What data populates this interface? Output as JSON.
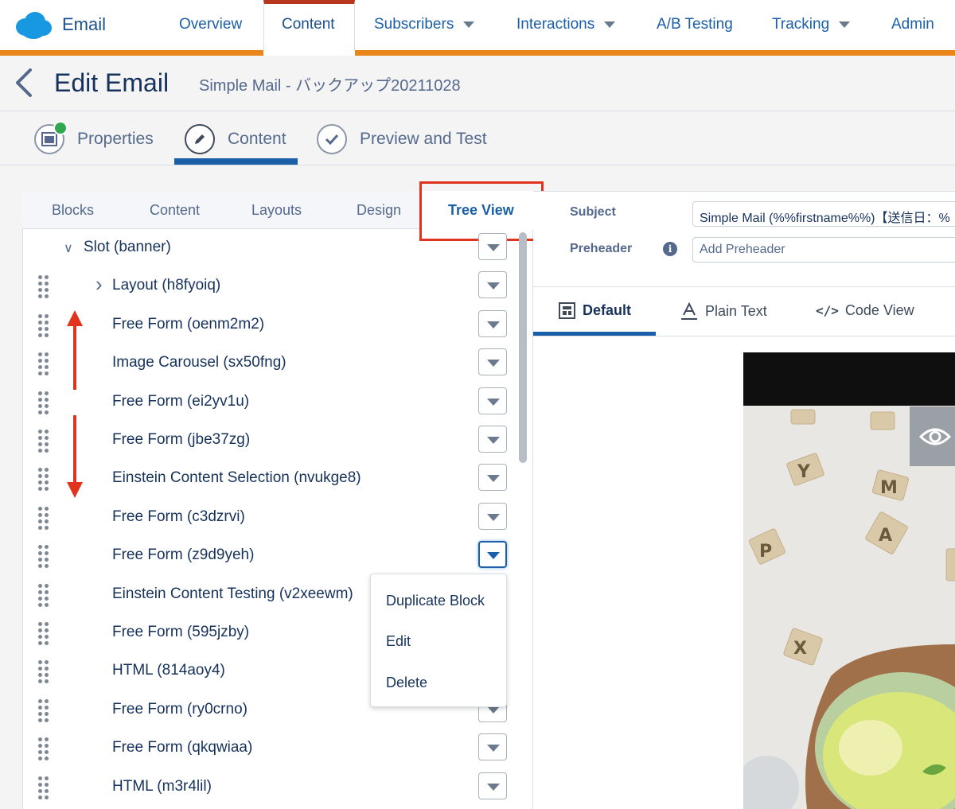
{
  "topnav": {
    "app_name": "Email",
    "items": [
      {
        "label": "Overview"
      },
      {
        "label": "Content",
        "active": true
      },
      {
        "label": "Subscribers",
        "dropdown": true
      },
      {
        "label": "Interactions",
        "dropdown": true
      },
      {
        "label": "A/B Testing"
      },
      {
        "label": "Tracking",
        "dropdown": true
      },
      {
        "label": "Admin"
      }
    ],
    "accent_color": "#e8861c"
  },
  "header": {
    "title": "Edit Email",
    "subtitle": "Simple Mail - バックアップ20211028"
  },
  "steps": [
    {
      "label": "Properties",
      "icon": "properties-icon",
      "completed": true
    },
    {
      "label": "Content",
      "icon": "pencil-icon",
      "active": true
    },
    {
      "label": "Preview and Test",
      "icon": "checkmark-icon"
    }
  ],
  "left_tabs": [
    {
      "label": "Blocks"
    },
    {
      "label": "Content"
    },
    {
      "label": "Layouts"
    },
    {
      "label": "Design"
    },
    {
      "label": "Tree View",
      "active": true
    }
  ],
  "tree": [
    {
      "label": "Slot (banner)",
      "type": "slot",
      "expanded": true
    },
    {
      "label": "Layout (h8fyoiq)",
      "type": "layout",
      "collapsed": true
    },
    {
      "label": "Free Form (oenm2m2)"
    },
    {
      "label": "Image Carousel (sx50fng)"
    },
    {
      "label": "Free Form (ei2yv1u)"
    },
    {
      "label": "Free Form (jbe37zg)"
    },
    {
      "label": "Einstein Content Selection (nvukge8)"
    },
    {
      "label": "Free Form (c3dzrvi)"
    },
    {
      "label": "Free Form (z9d9yeh)",
      "menu_open": true
    },
    {
      "label": "Einstein Content Testing (v2xeewm)"
    },
    {
      "label": "Free Form (595jzby)"
    },
    {
      "label": "HTML (814aoy4)"
    },
    {
      "label": "Free Form (ry0crno)"
    },
    {
      "label": "Free Form (qkqwiaa)"
    },
    {
      "label": "HTML (m3r4lil)"
    }
  ],
  "context_menu": {
    "items": [
      {
        "label": "Duplicate Block"
      },
      {
        "label": "Edit"
      },
      {
        "label": "Delete"
      }
    ]
  },
  "email_fields": {
    "subject_label": "Subject",
    "subject_value": "Simple Mail (%%firstname%%)【送信日：%",
    "preheader_label": "Preheader",
    "preheader_placeholder": "Add Preheader"
  },
  "preview_tabs": [
    {
      "label": "Default",
      "icon": "layout-icon",
      "active": true
    },
    {
      "label": "Plain Text",
      "icon": "text-a-icon"
    },
    {
      "label": "Code View",
      "icon": "code-icon"
    }
  ],
  "colors": {
    "link_blue": "#1b5fa8",
    "highlight_red": "#e0341f",
    "success_green": "#2fa84f"
  }
}
